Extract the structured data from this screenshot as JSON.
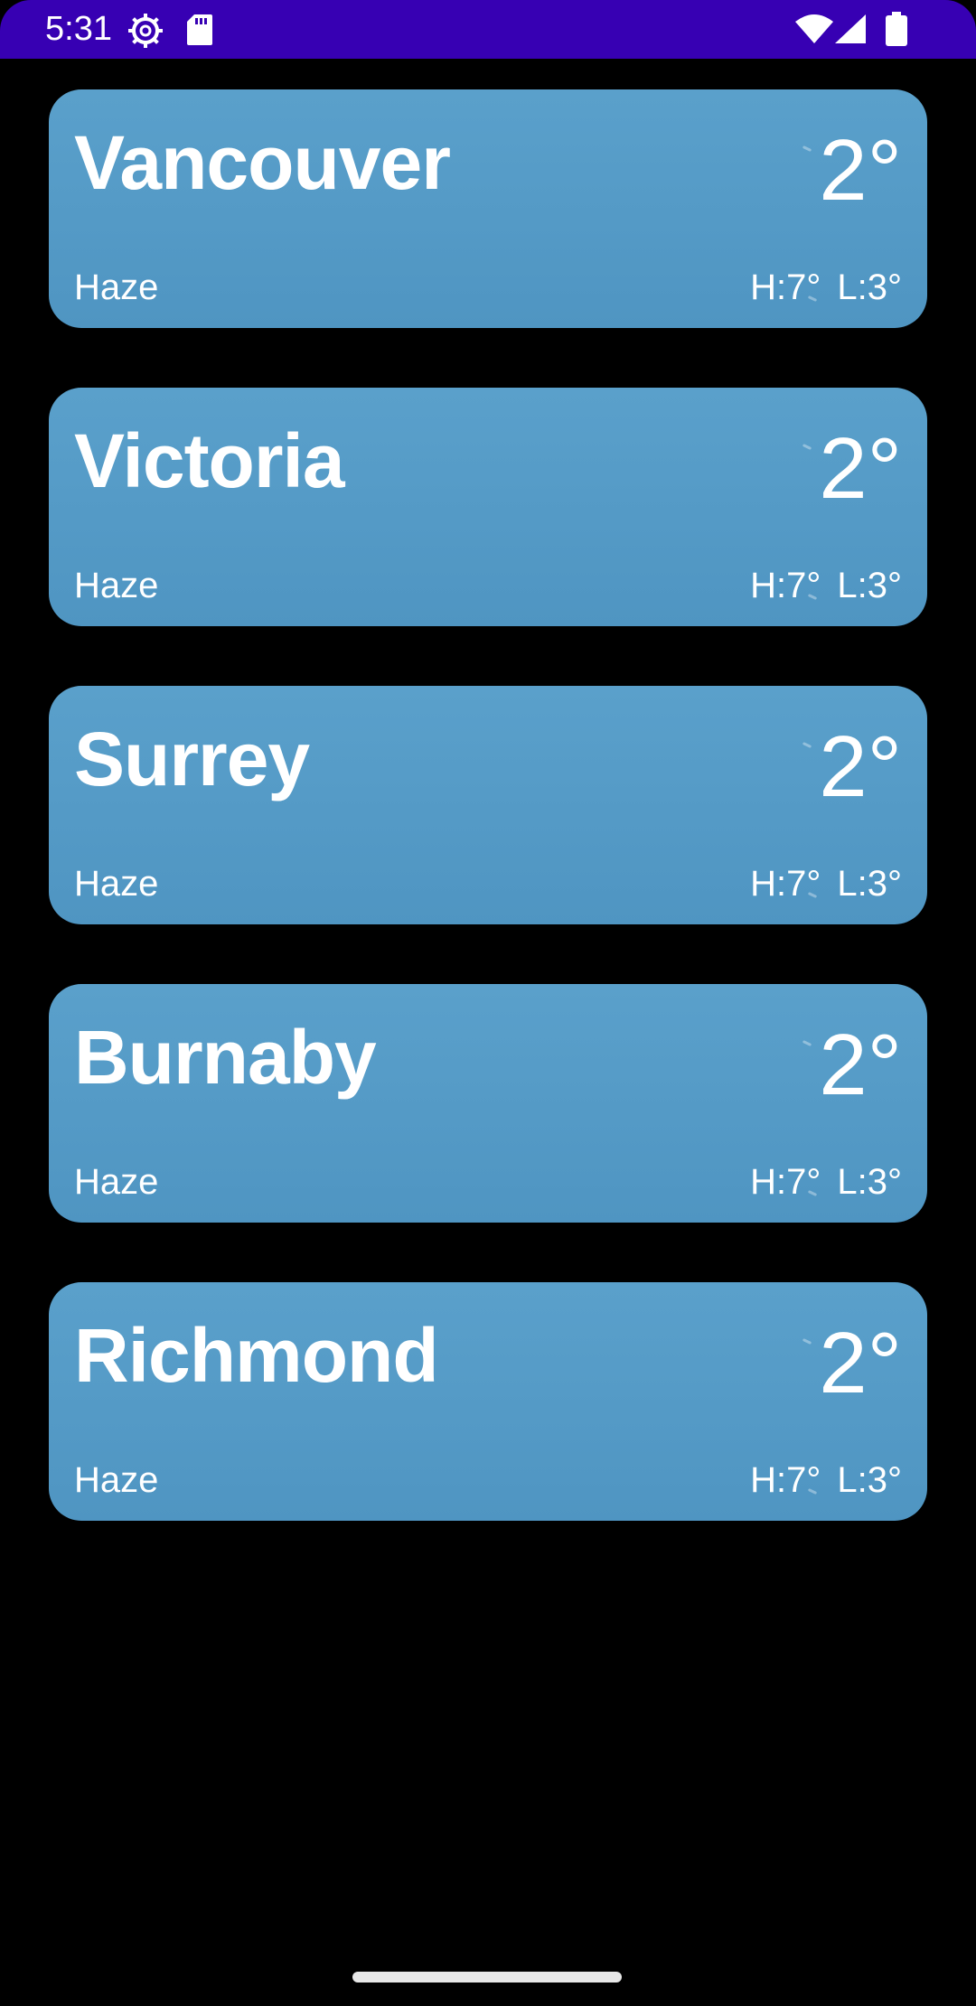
{
  "status_bar": {
    "time": "5:31",
    "icons": [
      "gear-icon",
      "sd-card-icon",
      "wifi-icon",
      "signal-icon",
      "battery-icon"
    ],
    "background_color": "#3700b3"
  },
  "theme": {
    "background": "#000000",
    "card_color": "#5aa0cb",
    "text_color": "#ffffff"
  },
  "cities": [
    {
      "name": "Vancouver",
      "temp": "2°",
      "condition": "Haze",
      "high": "H:7°",
      "low": "L:3°"
    },
    {
      "name": "Victoria",
      "temp": "2°",
      "condition": "Haze",
      "high": "H:7°",
      "low": "L:3°"
    },
    {
      "name": "Surrey",
      "temp": "2°",
      "condition": "Haze",
      "high": "H:7°",
      "low": "L:3°"
    },
    {
      "name": "Burnaby",
      "temp": "2°",
      "condition": "Haze",
      "high": "H:7°",
      "low": "L:3°"
    },
    {
      "name": "Richmond",
      "temp": "2°",
      "condition": "Haze",
      "high": "H:7°",
      "low": "L:3°"
    }
  ]
}
